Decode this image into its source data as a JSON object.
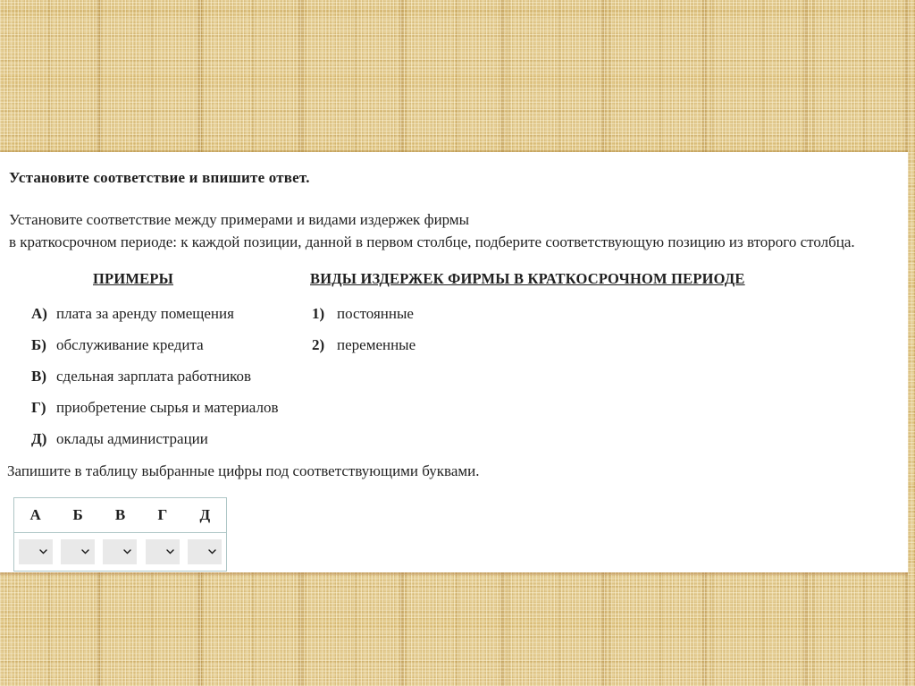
{
  "task": {
    "title": "Установите соответствие и впишите ответ.",
    "description": [
      "Установите соответствие между примерами и видами издержек фирмы",
      "в краткосрочном периоде: к каждой позиции, данной в первом столбце, подберите соответствующую позицию из второго столбца."
    ]
  },
  "matching": {
    "left_header": "ПРИМЕРЫ",
    "right_header": "ВИДЫ ИЗДЕРЖЕК ФИРМЫ В КРАТКОСРОЧНОМ ПЕРИОДЕ",
    "left_items": [
      {
        "label": "А)",
        "text": "плата за аренду помещения"
      },
      {
        "label": "Б)",
        "text": "обслуживание кредита"
      },
      {
        "label": "В)",
        "text": "сдельная зарплата работников"
      },
      {
        "label": "Г)",
        "text": "приобретение сырья и материалов"
      },
      {
        "label": "Д)",
        "text": "оклады администрации"
      }
    ],
    "right_items": [
      {
        "label": "1)",
        "text": "постоянные"
      },
      {
        "label": "2)",
        "text": "переменные"
      }
    ]
  },
  "answer": {
    "instruction": "Запишите в таблицу выбранные цифры под соответствующими буквами.",
    "columns": [
      "А",
      "Б",
      "В",
      "Г",
      "Д"
    ],
    "selected_values": [
      "",
      "",
      "",
      "",
      ""
    ]
  },
  "colors": {
    "texture_base": "#e6cf96",
    "panel_bg": "#ffffff",
    "text": "#1f1f1f",
    "table_border": "#aec6c6",
    "select_bg": "#e9e9e9",
    "chevron": "#1a1a1a"
  }
}
